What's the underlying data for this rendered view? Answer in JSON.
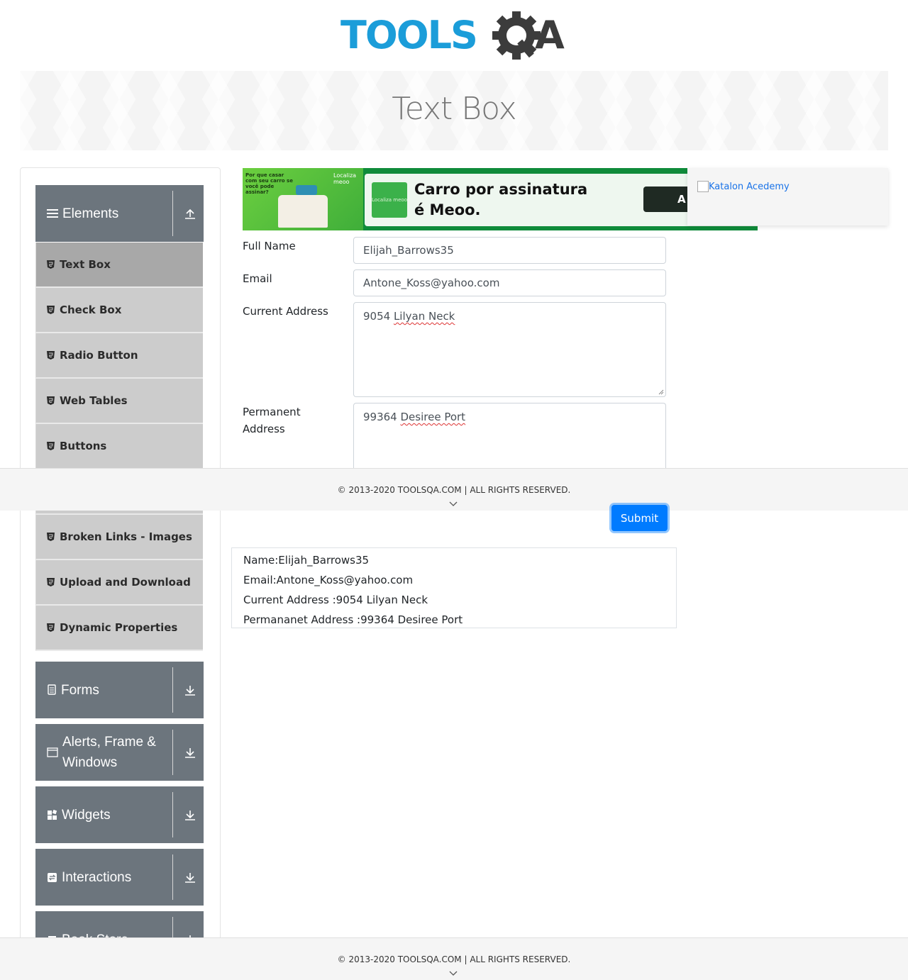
{
  "brand": {
    "logo_text_blue": "TOOLS",
    "logo_text_dark_q": "Q",
    "logo_text_dark_a": "A"
  },
  "page": {
    "title": "Text Box"
  },
  "sidebar": {
    "groups": [
      {
        "label": "Elements",
        "icon": "hamburger-icon",
        "expanded": true
      },
      {
        "label": "Forms",
        "icon": "document-icon",
        "expanded": false
      },
      {
        "label": "Alerts, Frame & Windows",
        "icon": "window-icon",
        "expanded": false
      },
      {
        "label": "Widgets",
        "icon": "widgets-icon",
        "expanded": false
      },
      {
        "label": "Interactions",
        "icon": "interactions-icon",
        "expanded": false
      },
      {
        "label": "Book Store",
        "icon": "book-icon",
        "expanded": false
      }
    ],
    "items": [
      {
        "label": "Text Box",
        "active": true
      },
      {
        "label": "Check Box"
      },
      {
        "label": "Radio Button"
      },
      {
        "label": "Web Tables"
      },
      {
        "label": "Buttons"
      },
      {
        "label": "Broken Links - Images"
      },
      {
        "label": "Upload and Download"
      },
      {
        "label": "Dynamic Properties"
      }
    ]
  },
  "ads": {
    "main": {
      "small_text": "Por que casar com seu carro se você pode assinar?",
      "brand": "Localiza meoo",
      "headline": "Carro por assinatura é Meoo.",
      "button_partial": "A"
    },
    "side": {
      "alt_text": "Katalon Acedemy"
    }
  },
  "form": {
    "full_name": {
      "label": "Full Name",
      "value": "Elijah_Barrows35"
    },
    "email": {
      "label": "Email",
      "value": "Antone_Koss@yahoo.com"
    },
    "current_address": {
      "label": "Current Address",
      "value_plain": "9054 ",
      "value_marked": "Lilyan Neck"
    },
    "permanent_address": {
      "label": "Permanent Address",
      "value_plain": "99364 ",
      "value_marked": "Desiree Port"
    },
    "submit_label": "Submit"
  },
  "output": {
    "name": "Name:Elijah_Barrows35",
    "email": "Email:Antone_Koss@yahoo.com",
    "current_address": "Current Address :9054 Lilyan Neck",
    "permanent_address": "Permananet Address :99364 Desiree Port"
  },
  "footer": {
    "text": "© 2013-2020 TOOLSQA.COM | ALL RIGHTS RESERVED."
  },
  "colors": {
    "brand_blue": "#1b9dd9",
    "brand_dark": "#3c3c3c",
    "sidebar_header": "#6c757d",
    "sidebar_item": "#cccccc",
    "sidebar_item_active": "#a8a8a8",
    "primary_button": "#007bff"
  }
}
